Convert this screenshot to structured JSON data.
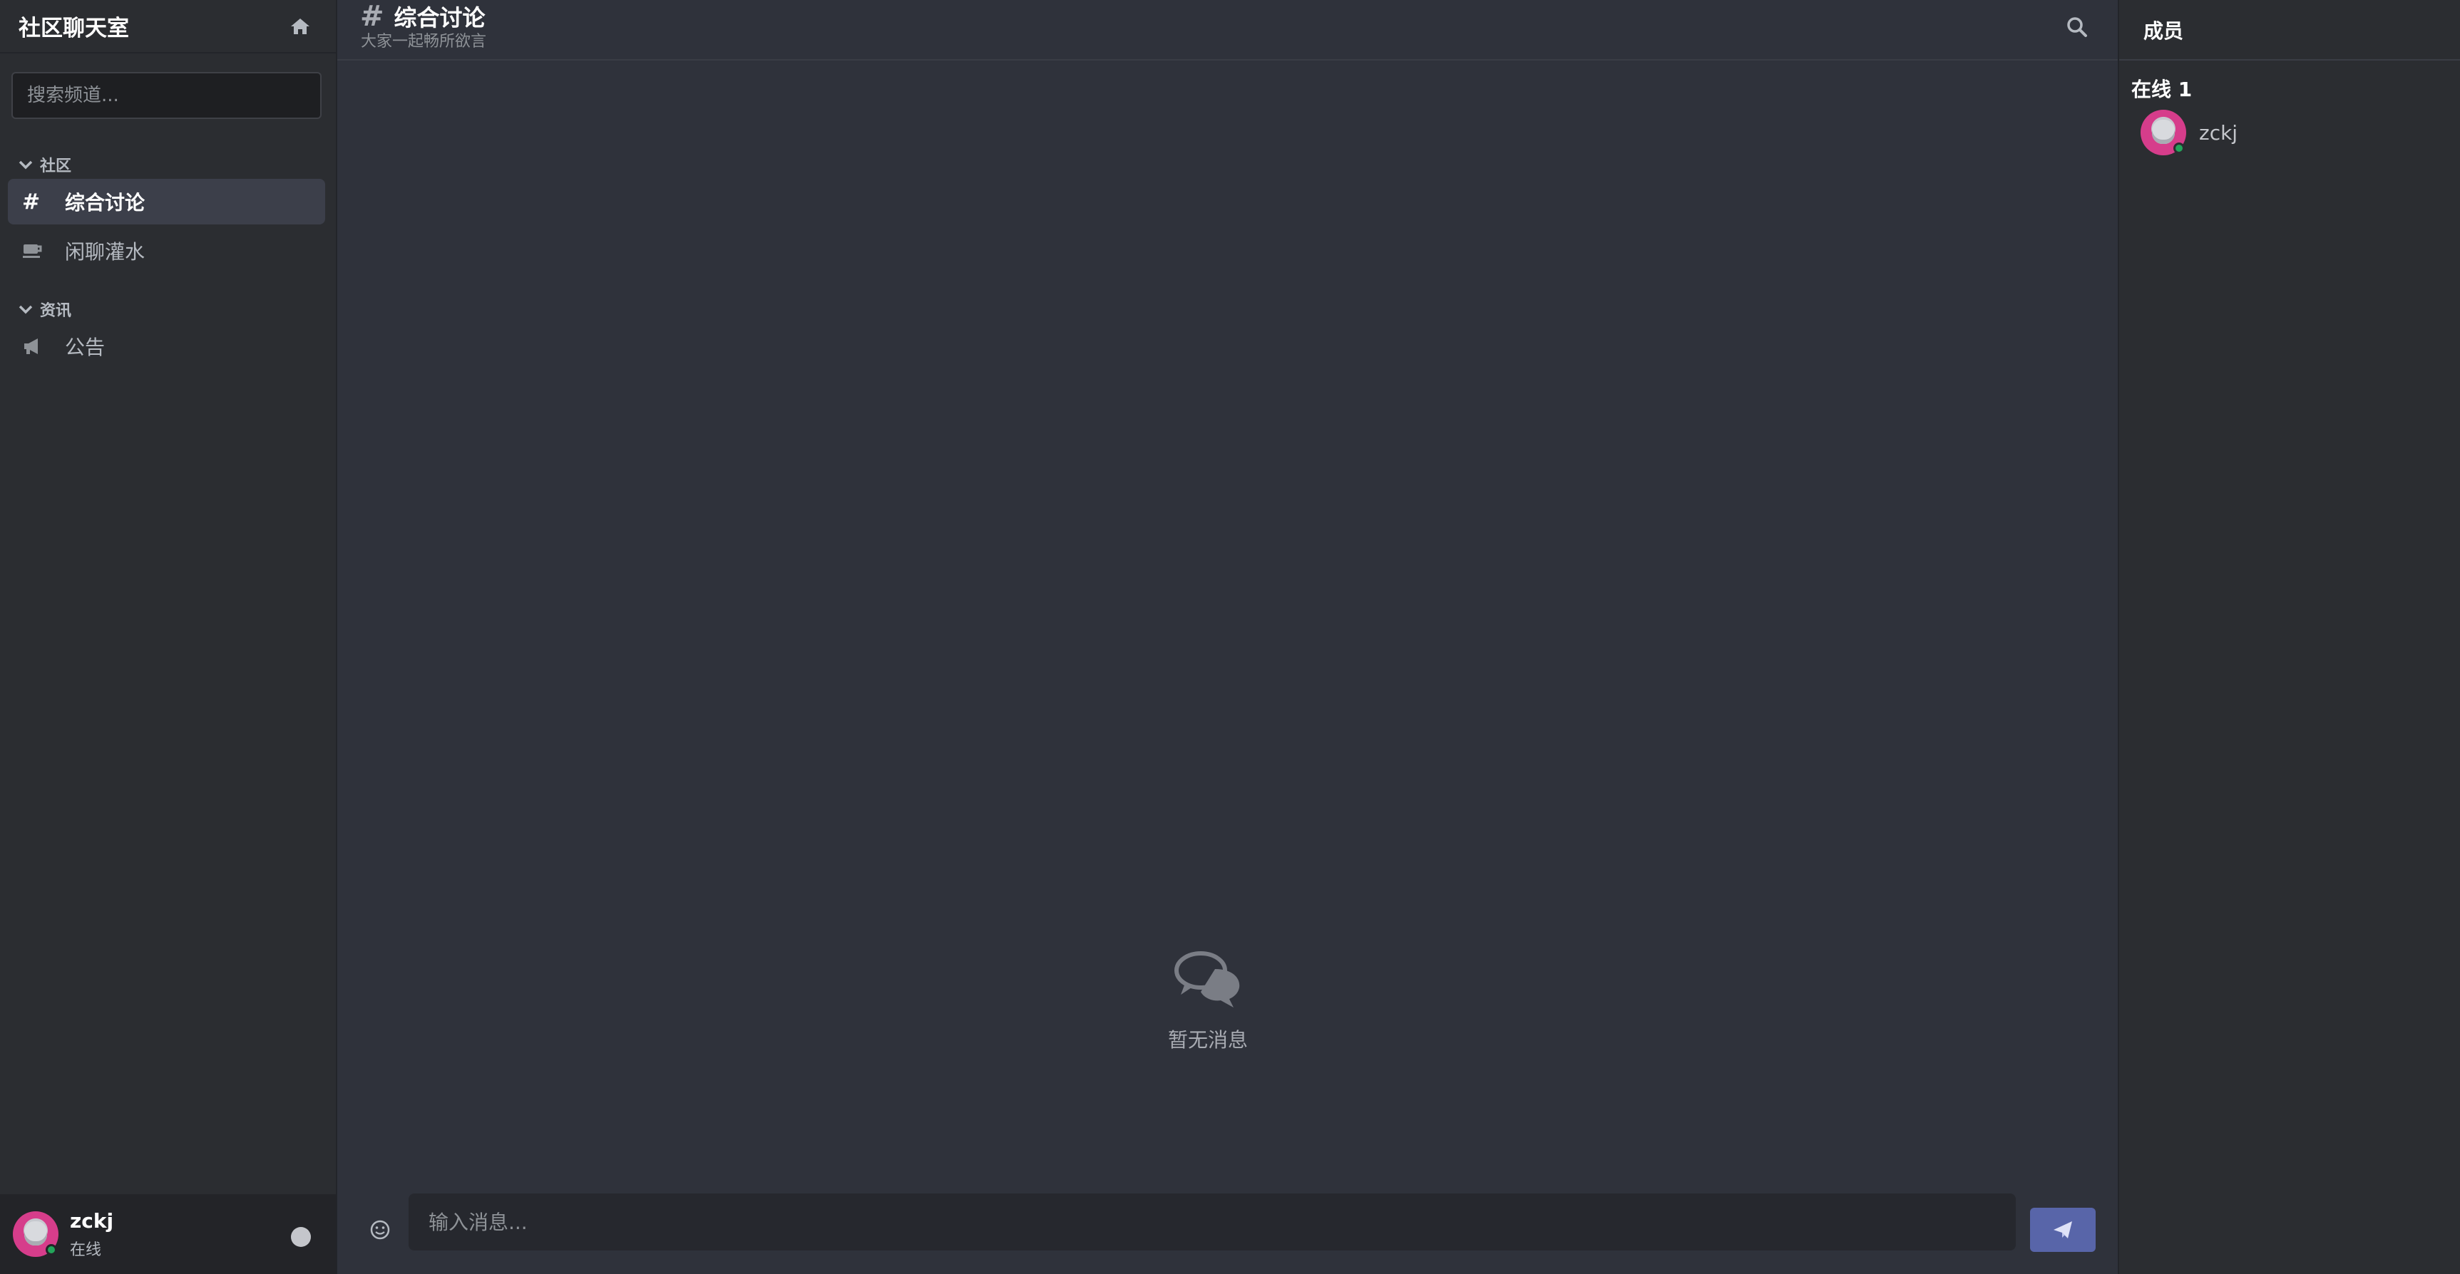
{
  "sidebar": {
    "title": "社区聊天室",
    "search_placeholder": "搜索频道...",
    "categories": [
      {
        "label": "社区",
        "channels": [
          {
            "label": "综合讨论",
            "icon": "hash-icon",
            "active": true
          },
          {
            "label": "闲聊灌水",
            "icon": "coffee-icon",
            "active": false
          }
        ]
      },
      {
        "label": "资讯",
        "channels": [
          {
            "label": "公告",
            "icon": "megaphone-icon",
            "active": false
          }
        ]
      }
    ],
    "user": {
      "name": "zckj",
      "status": "在线"
    }
  },
  "main": {
    "channel_title": "综合讨论",
    "channel_subtitle": "大家一起畅所欲言",
    "empty_text": "暂无消息",
    "input_placeholder": "输入消息...",
    "icons": {
      "header_search": "search-icon",
      "empty": "chat-bubbles-icon",
      "emoji": "smile-icon",
      "send": "paper-plane-icon"
    }
  },
  "members": {
    "title": "成员",
    "online_label": "在线 1",
    "list": [
      {
        "name": "zckj",
        "status": "online"
      }
    ]
  },
  "colors": {
    "accent": "#5865a9",
    "online": "#23a55a",
    "background": "#2f323b",
    "sidebar": "#2b2d31"
  }
}
